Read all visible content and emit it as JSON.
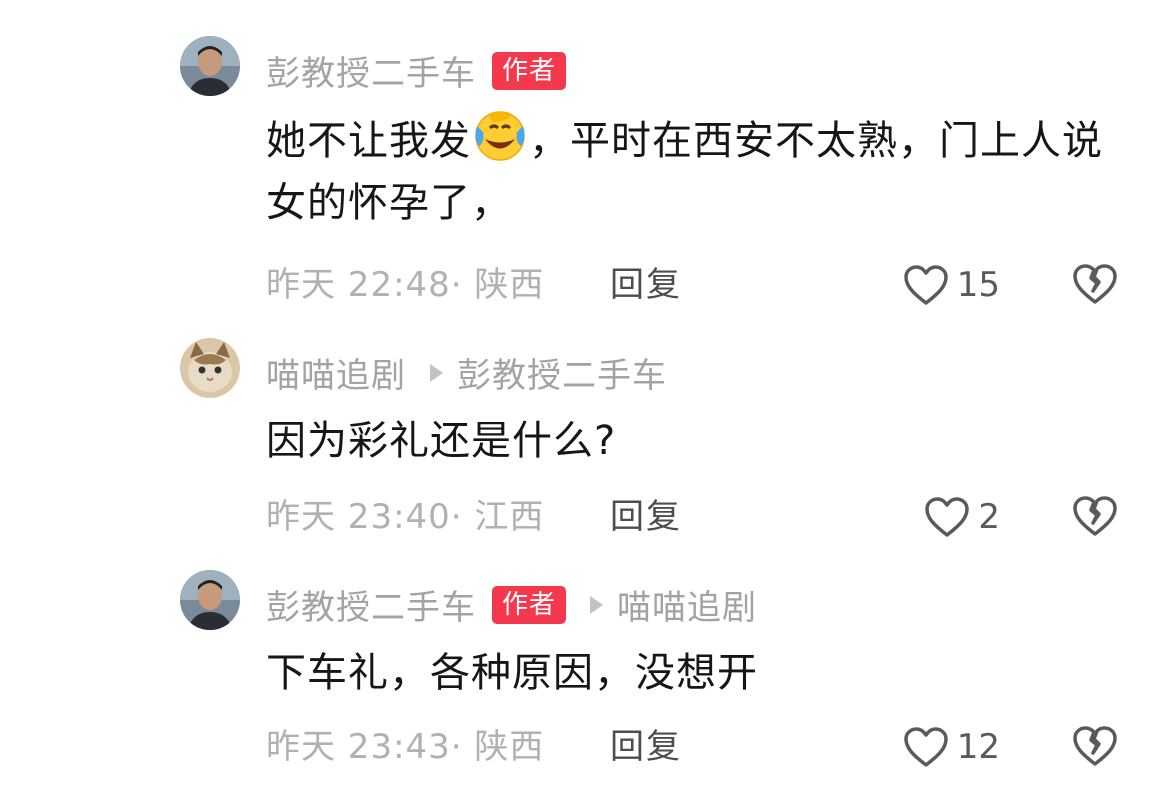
{
  "comments": [
    {
      "username": "彭教授二手车",
      "badge": "作者",
      "reply_to": "",
      "text_before_emoji": "她不让我发",
      "emoji": "laughing-crying-emoji",
      "text_after_emoji": "，平时在西安不太熟，门上人说女的怀孕了，",
      "time_location": "昨天 22:48· 陕西",
      "reply_label": "回复",
      "likes": "15"
    },
    {
      "username": "喵喵追剧",
      "badge": "",
      "reply_to": "彭教授二手车",
      "text": "因为彩礼还是什么?",
      "time_location": "昨天 23:40· 江西",
      "reply_label": "回复",
      "likes": "2"
    },
    {
      "username": "彭教授二手车",
      "badge": "作者",
      "reply_to": "喵喵追剧",
      "text": "下车礼，各种原因，没想开",
      "time_location": "昨天 23:43· 陕西",
      "reply_label": "回复",
      "likes": "12"
    }
  ],
  "colors": {
    "author_badge": "#f4394f",
    "username": "#a3a3a6",
    "body_text": "#161616",
    "meta_text": "#b1b1b4"
  }
}
